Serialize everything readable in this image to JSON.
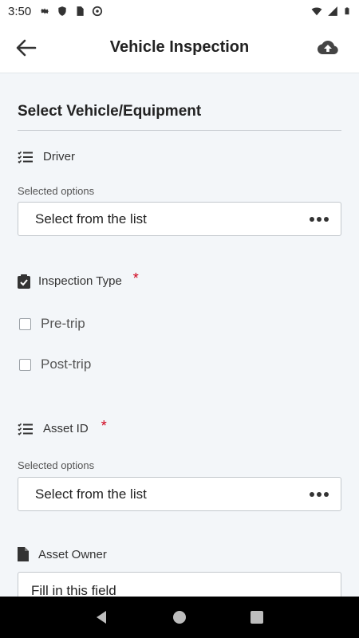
{
  "status_bar": {
    "time": "3:50",
    "left_icons": [
      "gear-icon",
      "shield-icon",
      "sd-card-icon",
      "at-sign-icon"
    ],
    "right_icons": [
      "wifi-icon",
      "signal-icon",
      "battery-icon"
    ]
  },
  "app_bar": {
    "title": "Vehicle Inspection",
    "back_icon": "arrow-left-icon",
    "upload_icon": "cloud-upload-icon"
  },
  "form": {
    "section_title": "Select Vehicle/Equipment",
    "driver": {
      "label": "Driver",
      "sub_label": "Selected options",
      "value": "Select from the list",
      "required": false
    },
    "inspection_type": {
      "label": "Inspection Type",
      "required_mark": "*",
      "options": [
        {
          "label": "Pre-trip",
          "checked": false
        },
        {
          "label": "Post-trip",
          "checked": false
        }
      ]
    },
    "asset_id": {
      "label": "Asset ID",
      "required_mark": "*",
      "sub_label": "Selected options",
      "value": "Select from the list"
    },
    "asset_owner": {
      "label": "Asset Owner",
      "value": "Fill in this field"
    }
  },
  "colors": {
    "accent_required": "#d0021b",
    "background": "#f3f6f9"
  }
}
